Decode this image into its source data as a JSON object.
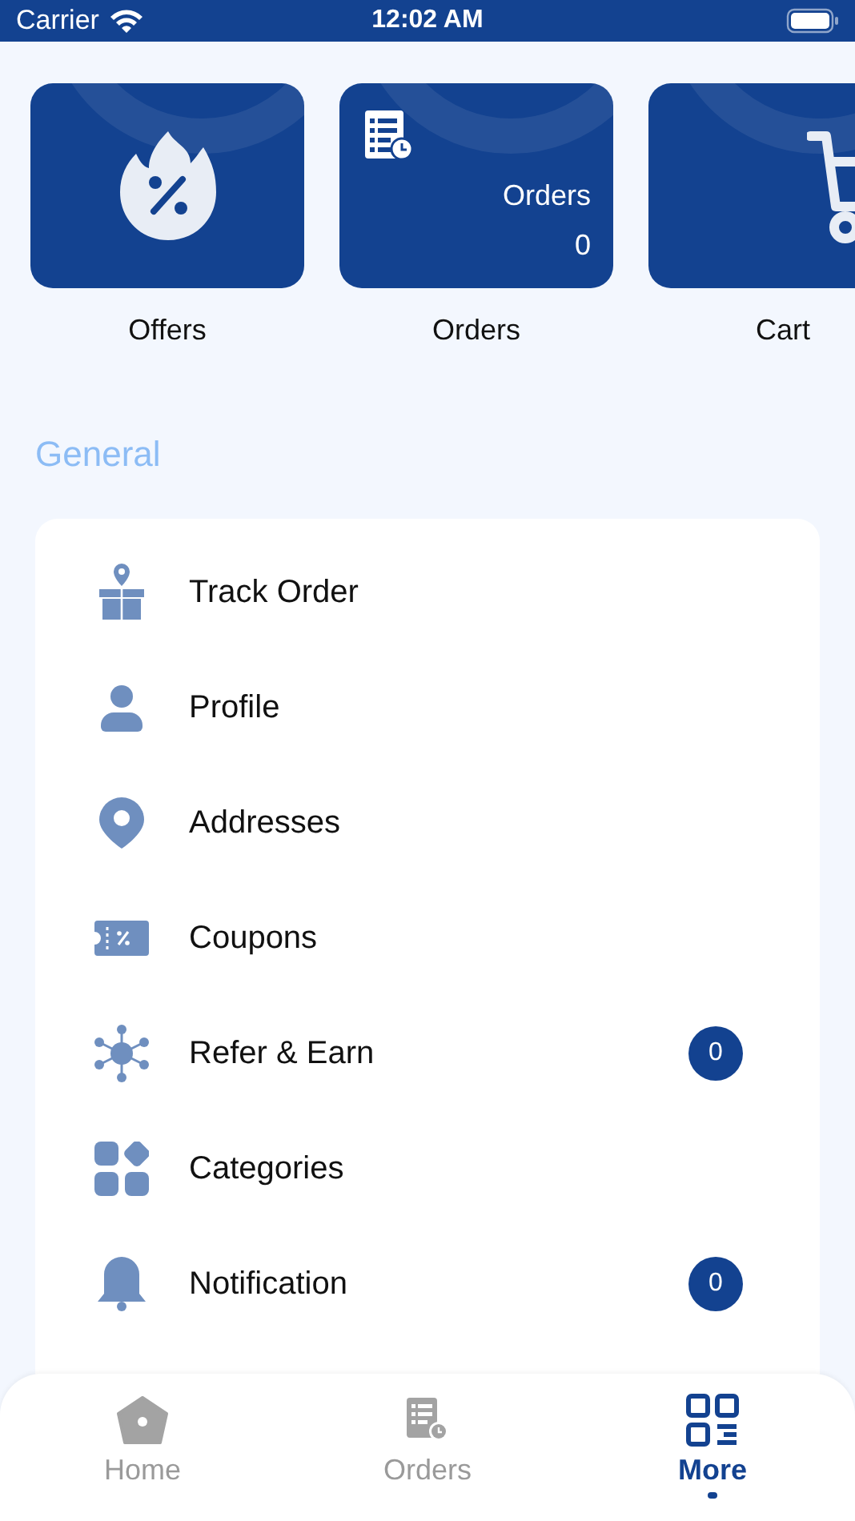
{
  "status_bar": {
    "carrier": "Carrier",
    "time": "12:02 AM"
  },
  "tiles": [
    {
      "kind": "icon",
      "label": "Offers"
    },
    {
      "kind": "summary",
      "title": "Orders",
      "count": "0",
      "label": "Orders"
    },
    {
      "kind": "icon",
      "label": "Cart"
    }
  ],
  "section_title": "General",
  "menu": [
    {
      "label": "Track Order"
    },
    {
      "label": "Profile"
    },
    {
      "label": "Addresses"
    },
    {
      "label": "Coupons"
    },
    {
      "label": "Refer & Earn",
      "badge": "0"
    },
    {
      "label": "Categories"
    },
    {
      "label": "Notification",
      "badge": "0"
    }
  ],
  "tabs": [
    {
      "label": "Home",
      "selected": false
    },
    {
      "label": "Orders",
      "selected": false
    },
    {
      "label": "More",
      "selected": true
    }
  ]
}
